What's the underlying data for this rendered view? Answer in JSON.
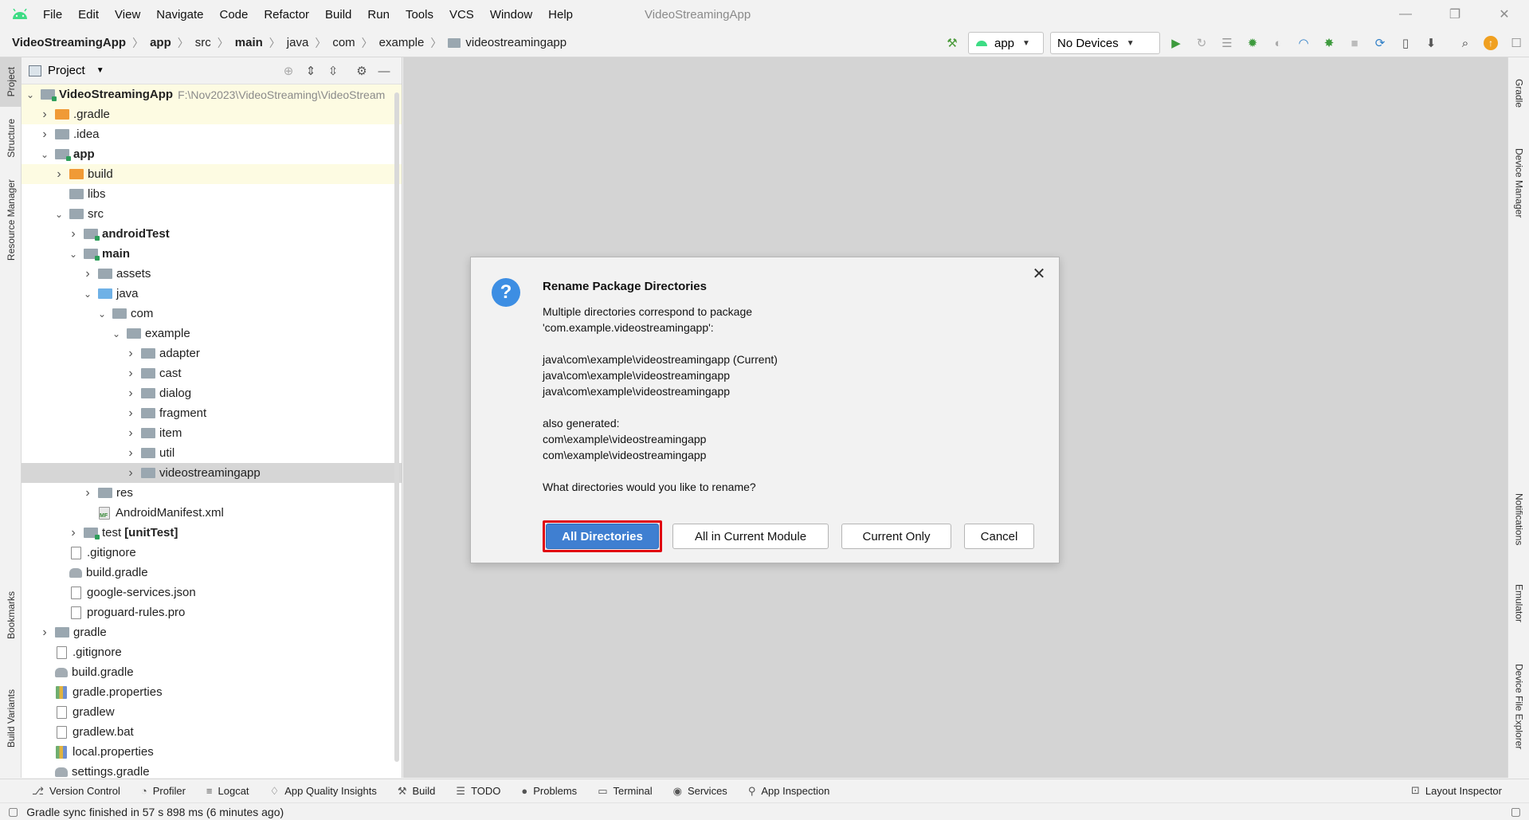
{
  "window": {
    "title": "VideoStreamingApp",
    "menu": [
      "File",
      "Edit",
      "View",
      "Navigate",
      "Code",
      "Refactor",
      "Build",
      "Run",
      "Tools",
      "VCS",
      "Window",
      "Help"
    ],
    "controls": {
      "minimize": "—",
      "restore": "❐",
      "close": "✕"
    }
  },
  "breadcrumb": [
    "VideoStreamingApp",
    "app",
    "src",
    "main",
    "java",
    "com",
    "example",
    "videostreamingapp"
  ],
  "toolbar": {
    "run_config": "app",
    "device": "No Devices",
    "icons": [
      "hammer-icon",
      "run-icon",
      "rerun-icon",
      "coverage-icon",
      "debug-icon",
      "profile-icon",
      "attach-debugger-icon",
      "stop-icon",
      "sync-gradle-icon",
      "avd-manager-icon",
      "sdk-manager-icon",
      "search-icon",
      "update-icon",
      "account-icon"
    ]
  },
  "left_tool_tabs": [
    "Project",
    "Structure",
    "Resource Manager",
    "Bookmarks",
    "Build Variants"
  ],
  "right_tool_tabs": [
    "Gradle",
    "Device Manager",
    "Notifications",
    "Emulator",
    "Device File Explorer"
  ],
  "project_panel": {
    "title": "Project",
    "tree": [
      {
        "label": "VideoStreamingApp",
        "path": "F:\\Nov2023\\VideoStreaming\\VideoStream",
        "indent": 0,
        "chevron": "down",
        "icon": "module",
        "bold": true,
        "highlight": "yellow"
      },
      {
        "label": ".gradle",
        "indent": 1,
        "chevron": "right",
        "icon": "orange",
        "highlight": "yellow"
      },
      {
        "label": ".idea",
        "indent": 1,
        "chevron": "right",
        "icon": "gray"
      },
      {
        "label": "app",
        "indent": 1,
        "chevron": "down",
        "icon": "module",
        "bold": true
      },
      {
        "label": "build",
        "indent": 2,
        "chevron": "right",
        "icon": "orange",
        "highlight": "yellow"
      },
      {
        "label": "libs",
        "indent": 2,
        "chevron": "none",
        "icon": "gray"
      },
      {
        "label": "src",
        "indent": 2,
        "chevron": "down",
        "icon": "gray"
      },
      {
        "label": "androidTest",
        "indent": 3,
        "chevron": "right",
        "icon": "module",
        "bold": true
      },
      {
        "label": "main",
        "indent": 3,
        "chevron": "down",
        "icon": "module",
        "bold": true
      },
      {
        "label": "assets",
        "indent": 4,
        "chevron": "right",
        "icon": "gray"
      },
      {
        "label": "java",
        "indent": 4,
        "chevron": "down",
        "icon": "blue"
      },
      {
        "label": "com",
        "indent": 5,
        "chevron": "down",
        "icon": "gray"
      },
      {
        "label": "example",
        "indent": 6,
        "chevron": "down",
        "icon": "gray"
      },
      {
        "label": "adapter",
        "indent": 7,
        "chevron": "right",
        "icon": "gray"
      },
      {
        "label": "cast",
        "indent": 7,
        "chevron": "right",
        "icon": "gray"
      },
      {
        "label": "dialog",
        "indent": 7,
        "chevron": "right",
        "icon": "gray"
      },
      {
        "label": "fragment",
        "indent": 7,
        "chevron": "right",
        "icon": "gray"
      },
      {
        "label": "item",
        "indent": 7,
        "chevron": "right",
        "icon": "gray"
      },
      {
        "label": "util",
        "indent": 7,
        "chevron": "right",
        "icon": "gray"
      },
      {
        "label": "videostreamingapp",
        "indent": 7,
        "chevron": "right",
        "icon": "gray",
        "highlight": "selected"
      },
      {
        "label": "res",
        "indent": 4,
        "chevron": "right",
        "icon": "gray"
      },
      {
        "label": "AndroidManifest.xml",
        "indent": 4,
        "chevron": "none",
        "icon": "xml"
      },
      {
        "label": "test",
        "suffix": "[unitTest]",
        "indent": 3,
        "chevron": "right",
        "icon": "module"
      },
      {
        "label": ".gitignore",
        "indent": 2,
        "chevron": "none",
        "icon": "file"
      },
      {
        "label": "build.gradle",
        "indent": 2,
        "chevron": "none",
        "icon": "gradlefile"
      },
      {
        "label": "google-services.json",
        "indent": 2,
        "chevron": "none",
        "icon": "file"
      },
      {
        "label": "proguard-rules.pro",
        "indent": 2,
        "chevron": "none",
        "icon": "file"
      },
      {
        "label": "gradle",
        "indent": 1,
        "chevron": "right",
        "icon": "gray"
      },
      {
        "label": ".gitignore",
        "indent": 1,
        "chevron": "none",
        "icon": "file"
      },
      {
        "label": "build.gradle",
        "indent": 1,
        "chevron": "none",
        "icon": "gradlefile"
      },
      {
        "label": "gradle.properties",
        "indent": 1,
        "chevron": "none",
        "icon": "props"
      },
      {
        "label": "gradlew",
        "indent": 1,
        "chevron": "none",
        "icon": "file"
      },
      {
        "label": "gradlew.bat",
        "indent": 1,
        "chevron": "none",
        "icon": "file"
      },
      {
        "label": "local.properties",
        "indent": 1,
        "chevron": "none",
        "icon": "props"
      },
      {
        "label": "settings.gradle",
        "indent": 1,
        "chevron": "none",
        "icon": "gradlefile"
      }
    ]
  },
  "dialog": {
    "title": "Rename Package Directories",
    "message_lines": [
      "Multiple directories correspond to package",
      "'com.example.videostreamingapp':",
      "",
      "java\\com\\example\\videostreamingapp (Current)",
      "java\\com\\example\\videostreamingapp",
      "java\\com\\example\\videostreamingapp",
      "",
      "also generated:",
      "com\\example\\videostreamingapp",
      "com\\example\\videostreamingapp",
      "",
      "What directories would you like to rename?"
    ],
    "buttons": {
      "all_directories": "All Directories",
      "all_in_module": "All in Current Module",
      "current_only": "Current Only",
      "cancel": "Cancel"
    },
    "highlight_color": "#e0000f"
  },
  "bottom_tabs": [
    {
      "label": "Version Control",
      "icon": "⎇"
    },
    {
      "label": "Profiler",
      "icon": "◔"
    },
    {
      "label": "Logcat",
      "icon": "≡"
    },
    {
      "label": "App Quality Insights",
      "icon": "♢"
    },
    {
      "label": "Build",
      "icon": "⚒"
    },
    {
      "label": "TODO",
      "icon": "☰"
    },
    {
      "label": "Problems",
      "icon": "●"
    },
    {
      "label": "Terminal",
      "icon": "▭"
    },
    {
      "label": "Services",
      "icon": "◉"
    },
    {
      "label": "App Inspection",
      "icon": "⚲"
    }
  ],
  "layout_inspector": "Layout Inspector",
  "status": {
    "text": "Gradle sync finished in 57 s 898 ms (6 minutes ago)"
  },
  "colors": {
    "accent": "#3f7fd1",
    "selection": "#d6d6d6",
    "yellow_row": "#fdfbe2",
    "editor_bg": "#d4d4d4"
  }
}
